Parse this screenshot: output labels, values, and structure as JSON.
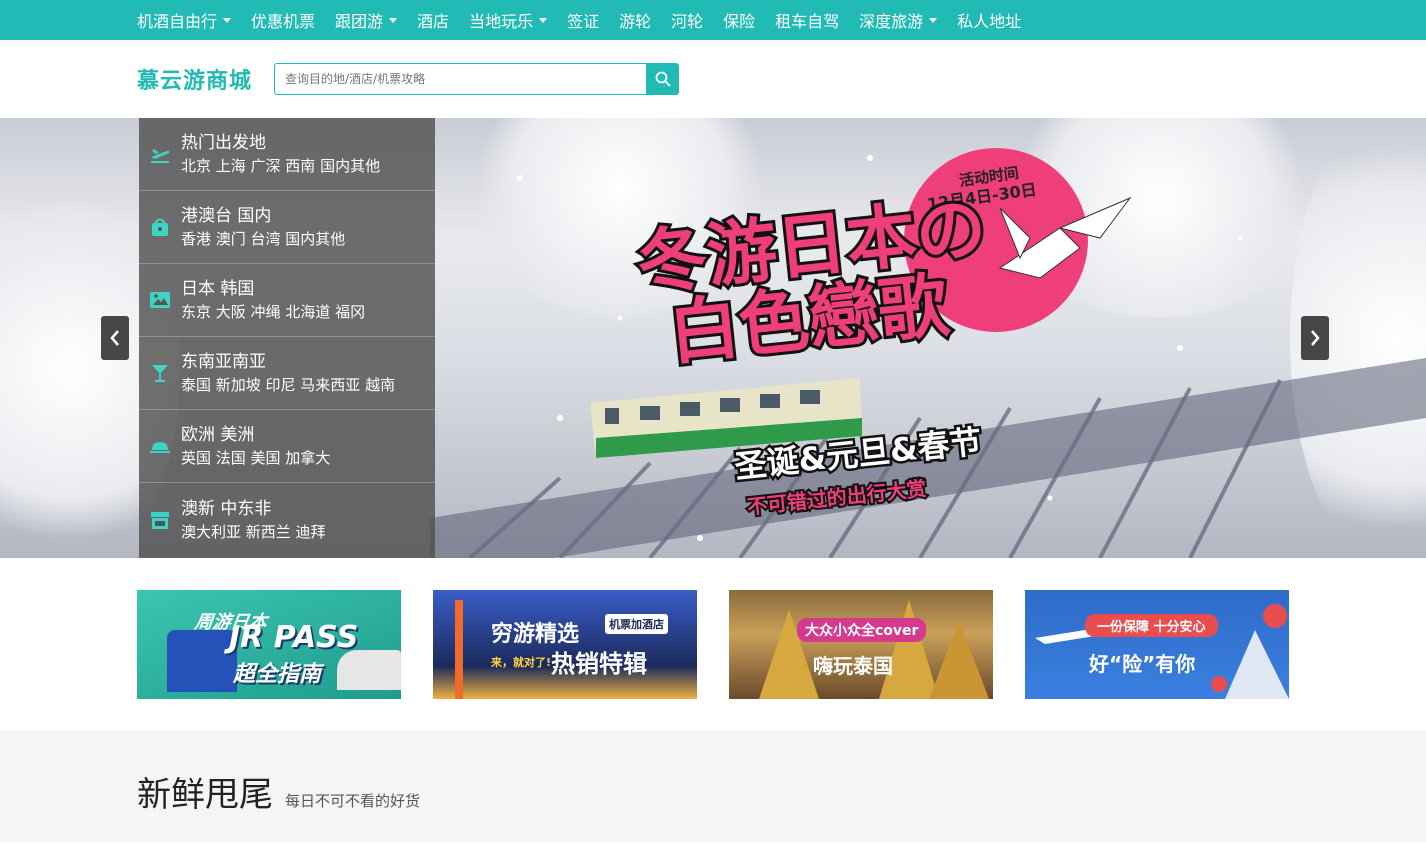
{
  "nav": {
    "items": [
      {
        "label": "机酒自由行",
        "dropdown": true
      },
      {
        "label": "优惠机票",
        "dropdown": false
      },
      {
        "label": "跟团游",
        "dropdown": true
      },
      {
        "label": "酒店",
        "dropdown": false
      },
      {
        "label": "当地玩乐",
        "dropdown": true
      },
      {
        "label": "签证",
        "dropdown": false
      },
      {
        "label": "游轮",
        "dropdown": false
      },
      {
        "label": "河轮",
        "dropdown": false
      },
      {
        "label": "保险",
        "dropdown": false
      },
      {
        "label": "租车自驾",
        "dropdown": false
      },
      {
        "label": "深度旅游",
        "dropdown": true
      },
      {
        "label": "私人地址",
        "dropdown": false
      }
    ]
  },
  "header": {
    "logo": "慕云游商城",
    "search_placeholder": "查询目的地/酒店/机票攻略"
  },
  "menu": [
    {
      "title": "热门出发地",
      "sub": "北京 上海 广深 西南 国内其他",
      "icon": "plane-departure-icon"
    },
    {
      "title": "港澳台 国内",
      "sub": "香港 澳门 台湾 国内其他",
      "icon": "shopping-bag-icon"
    },
    {
      "title": "日本 韩国",
      "sub": "东京 大阪 冲绳 北海道 福冈",
      "icon": "image-icon"
    },
    {
      "title": "东南亚南亚",
      "sub": "泰国 新加坡 印尼 马来西亚 越南",
      "icon": "cocktail-icon"
    },
    {
      "title": "欧洲 美洲",
      "sub": "英国 法国 美国 加拿大",
      "icon": "cloud-icon"
    },
    {
      "title": "澳新 中东非",
      "sub": "澳大利亚 新西兰 迪拜",
      "icon": "store-icon"
    }
  ],
  "banner": {
    "activity_label": "活动时间",
    "activity_date": "12月4日-30日",
    "headline_1": "冬游日本の",
    "headline_2": "白色戀歌",
    "tagline_1": "圣诞&元旦&春节",
    "tagline_2": "不可错过的出行大赏"
  },
  "promos": [
    {
      "line1": "周游日本",
      "line2": "JR PASS",
      "line3": "超全指南",
      "bg": "#2fb8a6"
    },
    {
      "line1": "穷游精选",
      "line2": "热销特辑",
      "tag": "机票加酒店",
      "small": "来，就对了!",
      "bg": "#1f3a7a"
    },
    {
      "badge": "大众小众全cover",
      "line1": "嗨玩泰国",
      "bg": "#b08a4a"
    },
    {
      "badge": "一份保障 十分安心",
      "line1": "好“险”有你",
      "bg": "#2f6cc9"
    }
  ],
  "section": {
    "title": "新鲜甩尾",
    "subtitle": "每日不可不看的好货"
  },
  "colors": {
    "accent": "#22bab5",
    "menu_icon": "#3fd3c3"
  }
}
